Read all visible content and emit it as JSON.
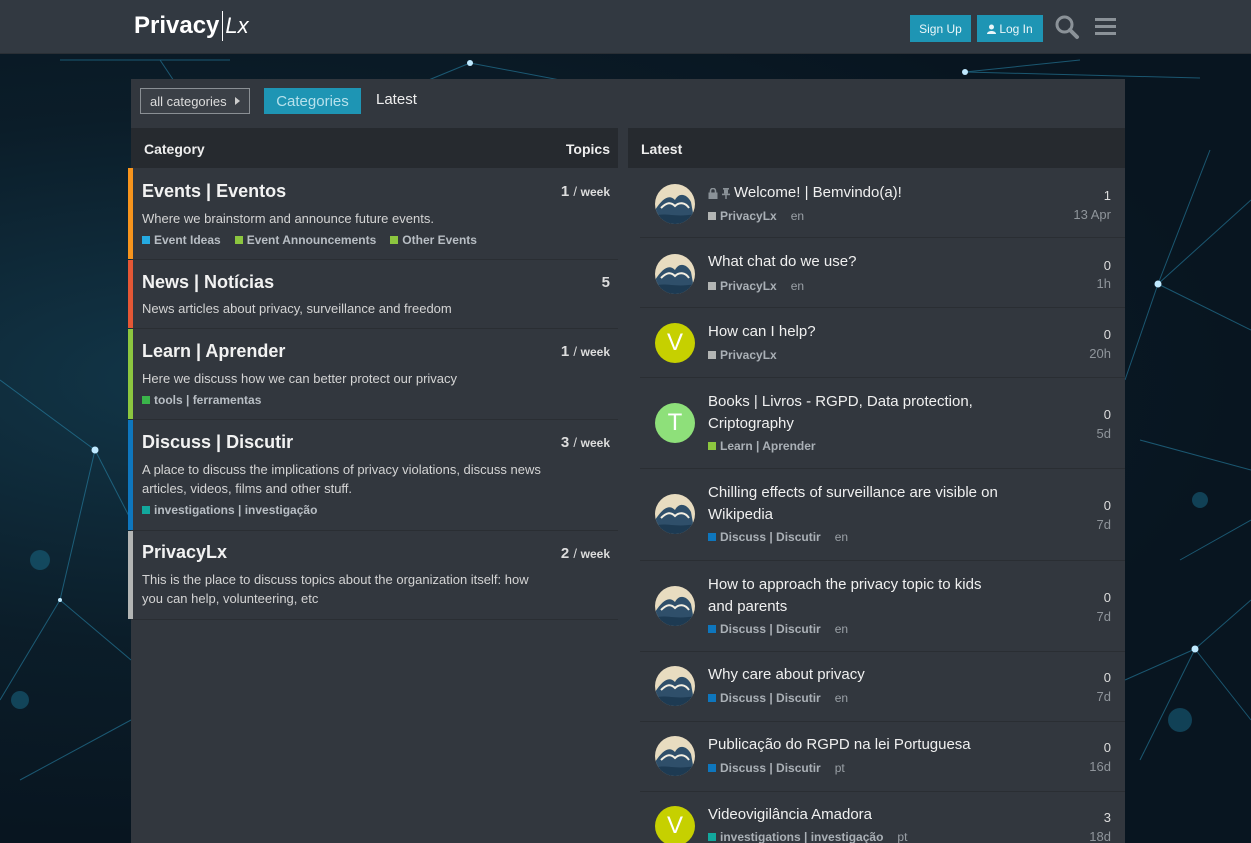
{
  "header": {
    "logo_main": "Privacy",
    "logo_sub": "Lx",
    "signup_label": "Sign Up",
    "login_label": "Log In"
  },
  "nav": {
    "category_dropdown": "all categories",
    "tab_categories": "Categories",
    "tab_latest": "Latest"
  },
  "columns": {
    "category": "Category",
    "topics": "Topics",
    "latest": "Latest"
  },
  "categories": [
    {
      "name": "Events | Eventos",
      "count": "1",
      "period": "week",
      "color": "#f7941d",
      "description": "Where we brainstorm and announce future events.",
      "subcategories": [
        {
          "label": "Event Ideas",
          "color": "#25aae1"
        },
        {
          "label": "Event Announcements",
          "color": "#8cc63f"
        },
        {
          "label": "Other Events",
          "color": "#8cc63f"
        }
      ]
    },
    {
      "name": "News | Notícias",
      "count": "5",
      "period": "",
      "color": "#e45735",
      "description": "News articles about privacy, surveillance and freedom",
      "subcategories": []
    },
    {
      "name": "Learn | Aprender",
      "count": "1",
      "period": "week",
      "color": "#8cc63f",
      "description": "Here we discuss how we can better protect our privacy",
      "subcategories": [
        {
          "label": "tools | ferramentas",
          "color": "#3ab54a"
        }
      ]
    },
    {
      "name": "Discuss | Discutir",
      "count": "3",
      "period": "week",
      "color": "#0e76bd",
      "description": "A place to discuss the implications of privacy violations, discuss news articles, videos, films and other stuff.",
      "subcategories": [
        {
          "label": "investigations | investigação",
          "color": "#12a89d"
        }
      ]
    },
    {
      "name": "PrivacyLx",
      "count": "2",
      "period": "week",
      "color": "#b3b5b4",
      "description": "This is the place to discuss topics about the organization itself: how you can help, volunteering, etc",
      "subcategories": []
    }
  ],
  "topics": [
    {
      "title": "Welcome! | Bemvindo(a)!",
      "category": "PrivacyLx",
      "cat_color": "#b3b5b4",
      "lang": "en",
      "replies": "1",
      "age": "13 Apr",
      "avatar": "wave",
      "icons": "lock-pin"
    },
    {
      "title": "What chat do we use?",
      "category": "PrivacyLx",
      "cat_color": "#b3b5b4",
      "lang": "en",
      "replies": "0",
      "age": "1h",
      "avatar": "wave"
    },
    {
      "title": "How can I help?",
      "category": "PrivacyLx",
      "cat_color": "#b3b5b4",
      "lang": "",
      "replies": "0",
      "age": "20h",
      "avatar": "V",
      "avatar_color": "#c6d000"
    },
    {
      "title": "Books | Livros - RGPD, Data protection, Criptography",
      "category": "Learn | Aprender",
      "cat_color": "#8cc63f",
      "lang": "",
      "replies": "0",
      "age": "5d",
      "avatar": "T",
      "avatar_color": "#8ee07a"
    },
    {
      "title": "Chilling effects of surveillance are visible on Wikipedia",
      "category": "Discuss | Discutir",
      "cat_color": "#0e76bd",
      "lang": "en",
      "replies": "0",
      "age": "7d",
      "avatar": "wave"
    },
    {
      "title": "How to approach the privacy topic to kids and parents",
      "category": "Discuss | Discutir",
      "cat_color": "#0e76bd",
      "lang": "en",
      "replies": "0",
      "age": "7d",
      "avatar": "wave"
    },
    {
      "title": "Why care about privacy",
      "category": "Discuss | Discutir",
      "cat_color": "#0e76bd",
      "lang": "en",
      "replies": "0",
      "age": "7d",
      "avatar": "wave"
    },
    {
      "title": "Publicação do RGPD na lei Portuguesa",
      "category": "Discuss | Discutir",
      "cat_color": "#0e76bd",
      "lang": "pt",
      "replies": "0",
      "age": "16d",
      "avatar": "wave"
    },
    {
      "title": "Videovigilância Amadora",
      "category": "investigations | investigação",
      "cat_color": "#12a89d",
      "lang": "pt",
      "replies": "3",
      "age": "18d",
      "avatar": "V",
      "avatar_color": "#c6d000"
    }
  ]
}
